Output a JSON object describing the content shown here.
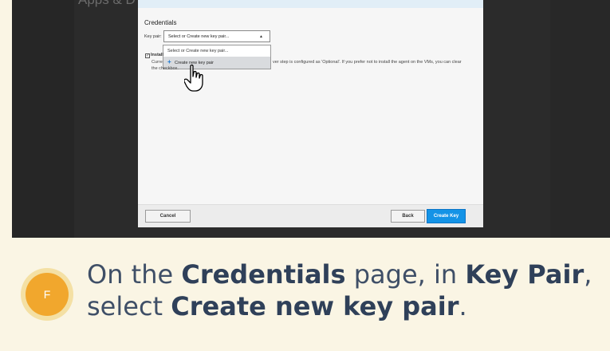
{
  "background": {
    "title_fragment": "Apps & D"
  },
  "dialog": {
    "section_title": "Credentials",
    "keypair_label": "Key pair:",
    "select": {
      "value": "Select or Create new key pair..."
    },
    "menu": {
      "items": [
        {
          "label": "Select or Create new key pair..."
        },
        {
          "label": "Create new key pair",
          "icon": "plus-icon"
        }
      ]
    },
    "checkbox_label": "Install",
    "curr_label": "Curre",
    "description": "ver step is configured as 'Optional'. If you prefer not to install the agent on the VMs, you can clear",
    "checkbox_text": "the checkbox.",
    "buttons": {
      "cancel": "Cancel",
      "back": "Back",
      "create": "Create Key"
    },
    "colors": {
      "primary_button": "#1493e6",
      "menu_highlight": "#d9dbde"
    }
  },
  "cursor": {
    "icon": "hand-pointer-icon"
  },
  "step": {
    "badge": "F",
    "instruction_parts": [
      {
        "text": "On the ",
        "bold": false
      },
      {
        "text": "Credentials",
        "bold": true
      },
      {
        "text": " page, in ",
        "bold": false
      },
      {
        "text": "Key Pair",
        "bold": true
      },
      {
        "text": ", select ",
        "bold": false
      },
      {
        "text": "Create new key pair",
        "bold": true
      },
      {
        "text": ".",
        "bold": false
      }
    ],
    "colors": {
      "badge": "#f1a72d",
      "badge_ring": "#f4e0a4",
      "background": "#faf5e4"
    }
  }
}
